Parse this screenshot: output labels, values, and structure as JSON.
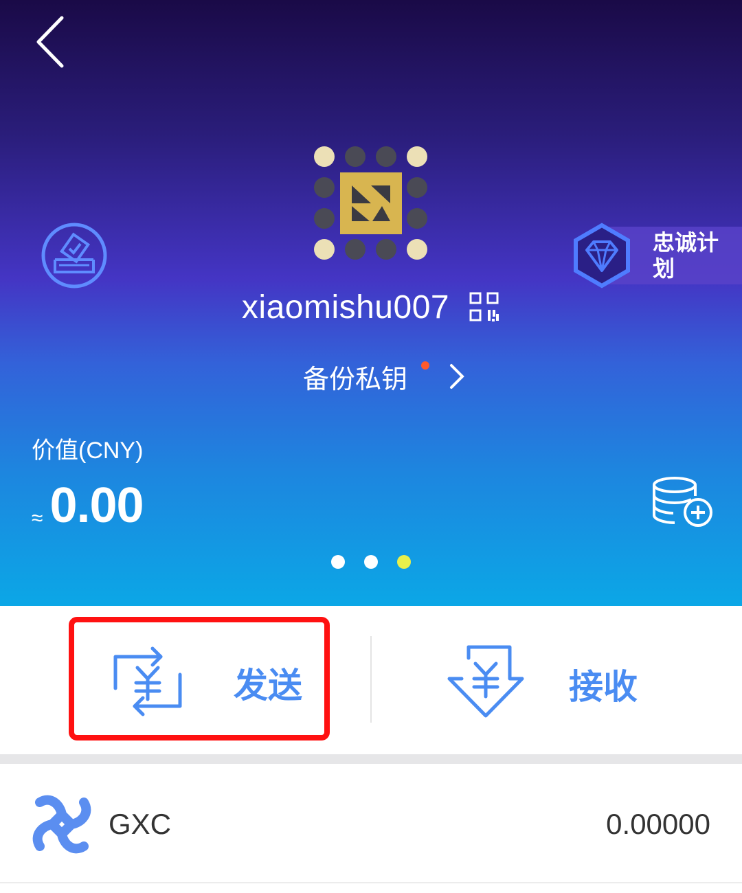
{
  "header": {
    "username": "xiaomishu007",
    "backup_label": "备份私钥",
    "loyalty_label": "忠诚计划",
    "value_label": "价值(CNY)",
    "approx_symbol": "≈",
    "value_amount": "0.00",
    "pager": {
      "count": 3,
      "active_index": 2,
      "active_color": "#e8f04a",
      "inactive_color": "#ffffff"
    },
    "icons": [
      "back-arrow-icon",
      "vote-icon",
      "avatar-icon",
      "qr-code-icon",
      "diamond-icon",
      "chevron-right-icon",
      "database-add-icon"
    ]
  },
  "actions": {
    "send_label": "发送",
    "send_icon": "yuan-transfer-icon",
    "receive_label": "接收",
    "receive_icon": "yuan-download-icon",
    "highlight_color": "#ff1111"
  },
  "tokens": [
    {
      "symbol": "GXC",
      "balance": "0.00000",
      "icon": "gxc-logo-icon"
    }
  ],
  "colors": {
    "accent": "#4a8cf2",
    "alert_dot": "#ff5a2a"
  }
}
